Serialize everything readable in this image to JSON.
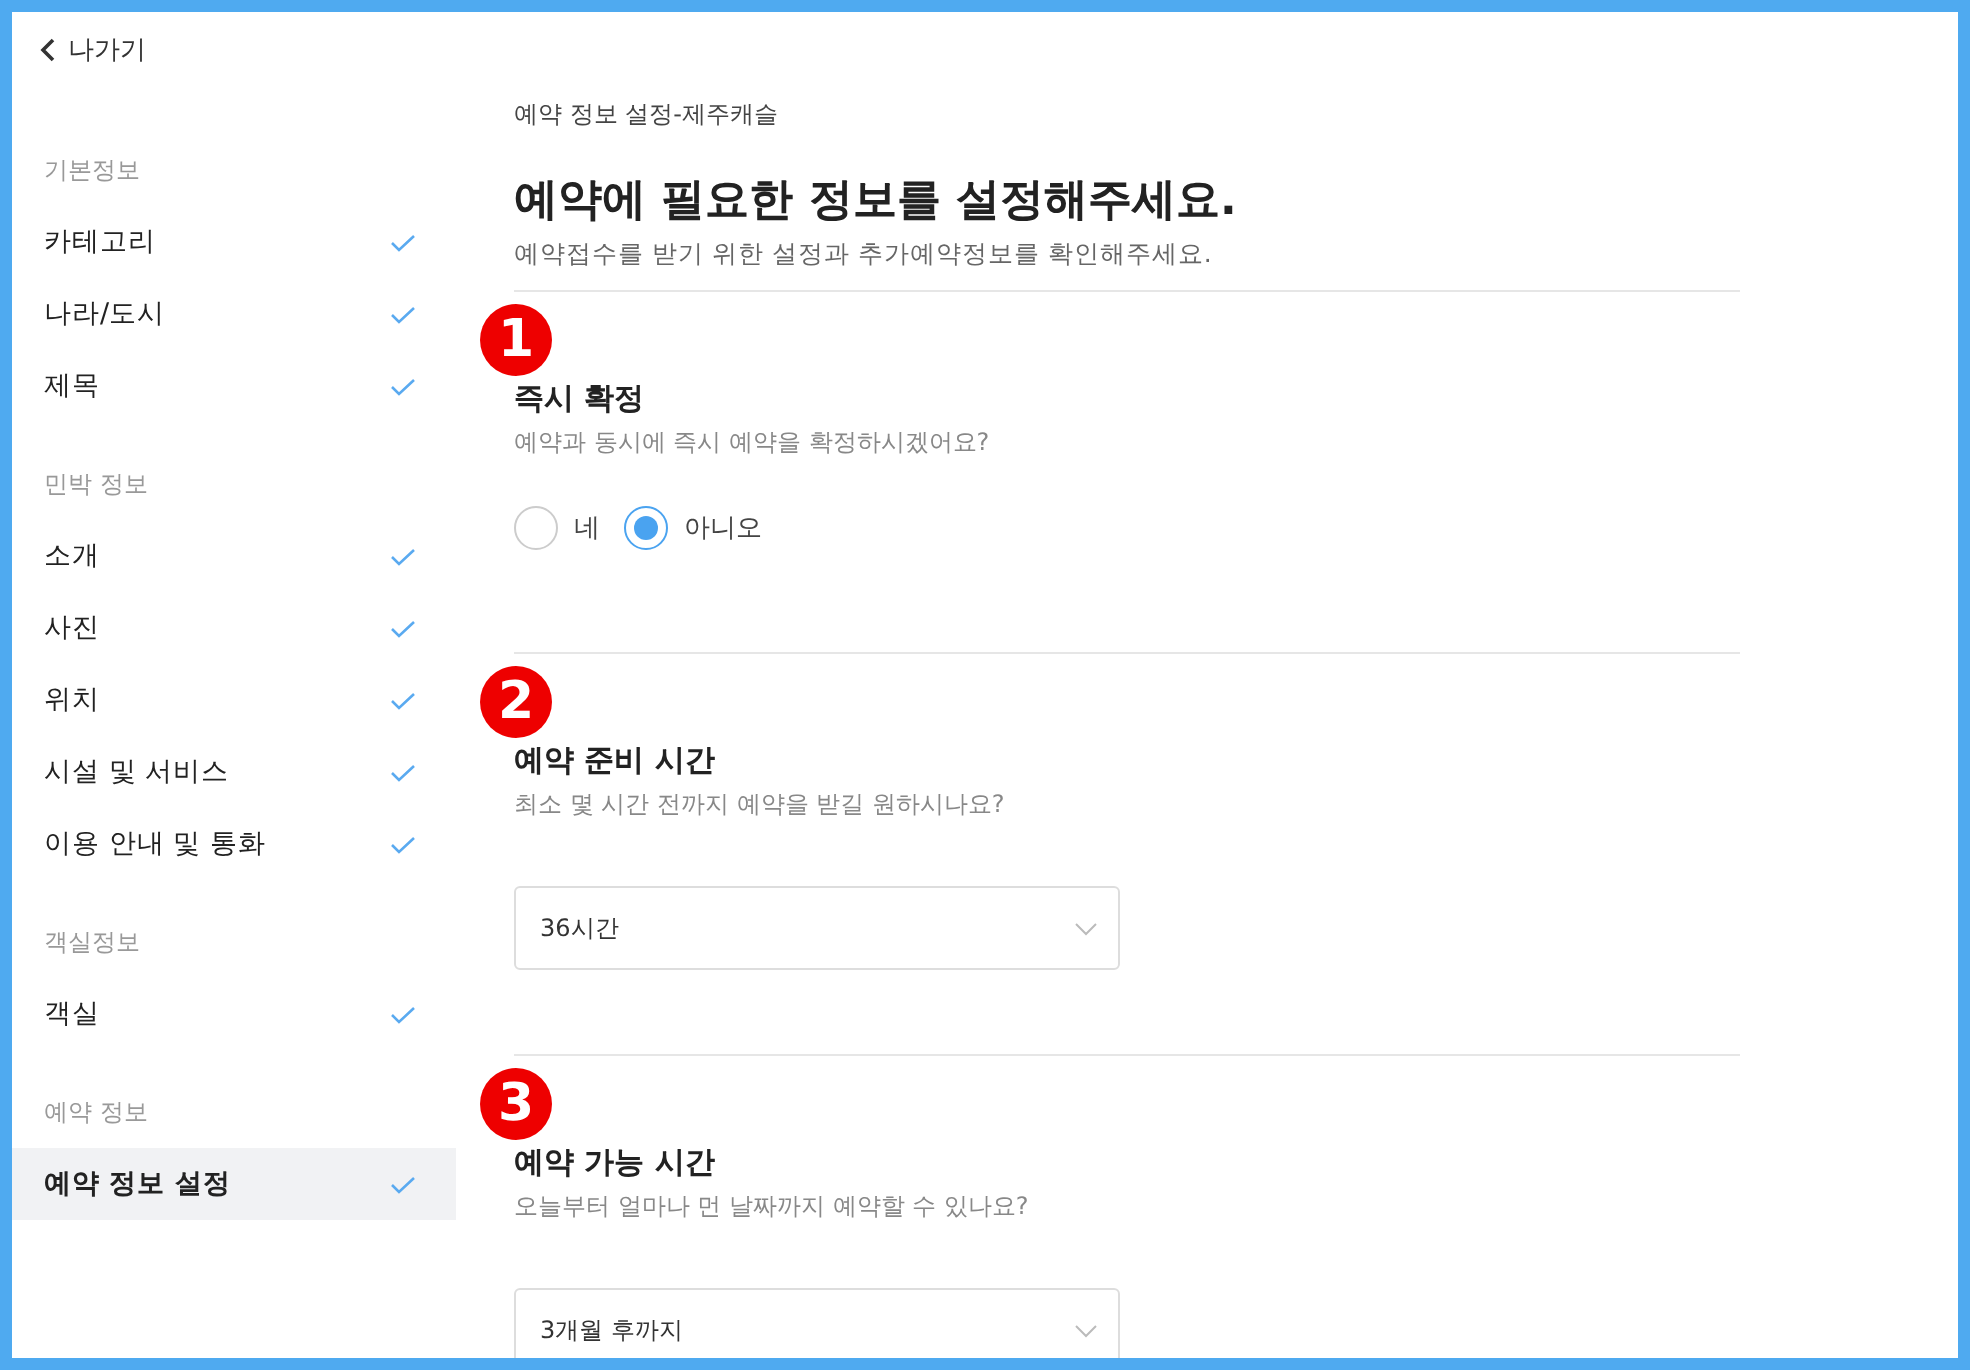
{
  "sidebar": {
    "back_label": "나가기",
    "groups": [
      {
        "label": "기본정보",
        "items": [
          {
            "label": "카테고리",
            "completed": true,
            "selected": false
          },
          {
            "label": "나라/도시",
            "completed": true,
            "selected": false
          },
          {
            "label": "제목",
            "completed": true,
            "selected": false
          }
        ]
      },
      {
        "label": "민박 정보",
        "items": [
          {
            "label": "소개",
            "completed": true,
            "selected": false
          },
          {
            "label": "사진",
            "completed": true,
            "selected": false
          },
          {
            "label": "위치",
            "completed": true,
            "selected": false
          },
          {
            "label": "시설 및 서비스",
            "completed": true,
            "selected": false
          },
          {
            "label": "이용 안내 및 통화",
            "completed": true,
            "selected": false
          }
        ]
      },
      {
        "label": "객실정보",
        "items": [
          {
            "label": "객실",
            "completed": true,
            "selected": false
          }
        ]
      },
      {
        "label": "예약 정보",
        "items": [
          {
            "label": "예약 정보 설정",
            "completed": true,
            "selected": true
          }
        ]
      }
    ]
  },
  "header": {
    "breadcrumb": "예약 정보 설정-제주캐슬",
    "title": "예약에 필요한 정보를 설정해주세요.",
    "subtitle": "예약접수를 받기 위한 설정과 추가예약정보를 확인해주세요."
  },
  "sections": [
    {
      "number": "1",
      "title": "즉시 확정",
      "description": "예약과 동시에 즉시 예약을 확정하시겠어요?",
      "kind": "radio",
      "options": [
        {
          "label": "네",
          "selected": false
        },
        {
          "label": "아니오",
          "selected": true
        }
      ]
    },
    {
      "number": "2",
      "title": "예약 준비 시간",
      "description": "최소 몇 시간 전까지 예약을 받길 원하시나요?",
      "kind": "select",
      "value": "36시간"
    },
    {
      "number": "3",
      "title": "예약 가능 시간",
      "description": "오늘부터 얼마나 먼 날짜까지 예약할 수 있나요?",
      "kind": "select",
      "value": "3개월 후까지"
    }
  ]
}
